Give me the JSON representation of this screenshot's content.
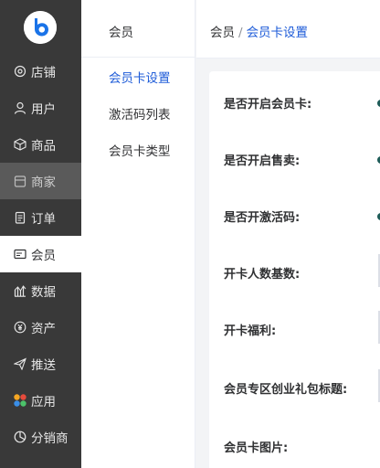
{
  "app": {
    "logo_letter": "b",
    "accent": "#1d5bd8",
    "sidebar_bg": "#393939"
  },
  "sidebar": {
    "items": [
      {
        "label": "店铺",
        "icon": "settings-icon"
      },
      {
        "label": "用户",
        "icon": "user-icon"
      },
      {
        "label": "商品",
        "icon": "cube-icon"
      },
      {
        "label": "商家",
        "icon": "store-icon"
      },
      {
        "label": "订单",
        "icon": "clipboard-icon"
      },
      {
        "label": "会员",
        "icon": "card-icon"
      },
      {
        "label": "数据",
        "icon": "chart-icon"
      },
      {
        "label": "资产",
        "icon": "yen-icon"
      },
      {
        "label": "推送",
        "icon": "send-icon"
      },
      {
        "label": "应用",
        "icon": "apps-icon"
      },
      {
        "label": "分销商",
        "icon": "pie-icon"
      }
    ]
  },
  "submenu": {
    "title": "会员",
    "items": [
      "会员卡设置",
      "激活码列表",
      "会员卡类型"
    ]
  },
  "breadcrumb": {
    "parent": "会员",
    "separator": "/",
    "current": "会员卡设置"
  },
  "form": {
    "fields": [
      "是否开启会员卡:",
      "是否开启售卖:",
      "是否开激活码:",
      "开卡人数基数:",
      "开卡福利:",
      "会员专区创业礼包标题:",
      "会员卡图片:"
    ]
  }
}
